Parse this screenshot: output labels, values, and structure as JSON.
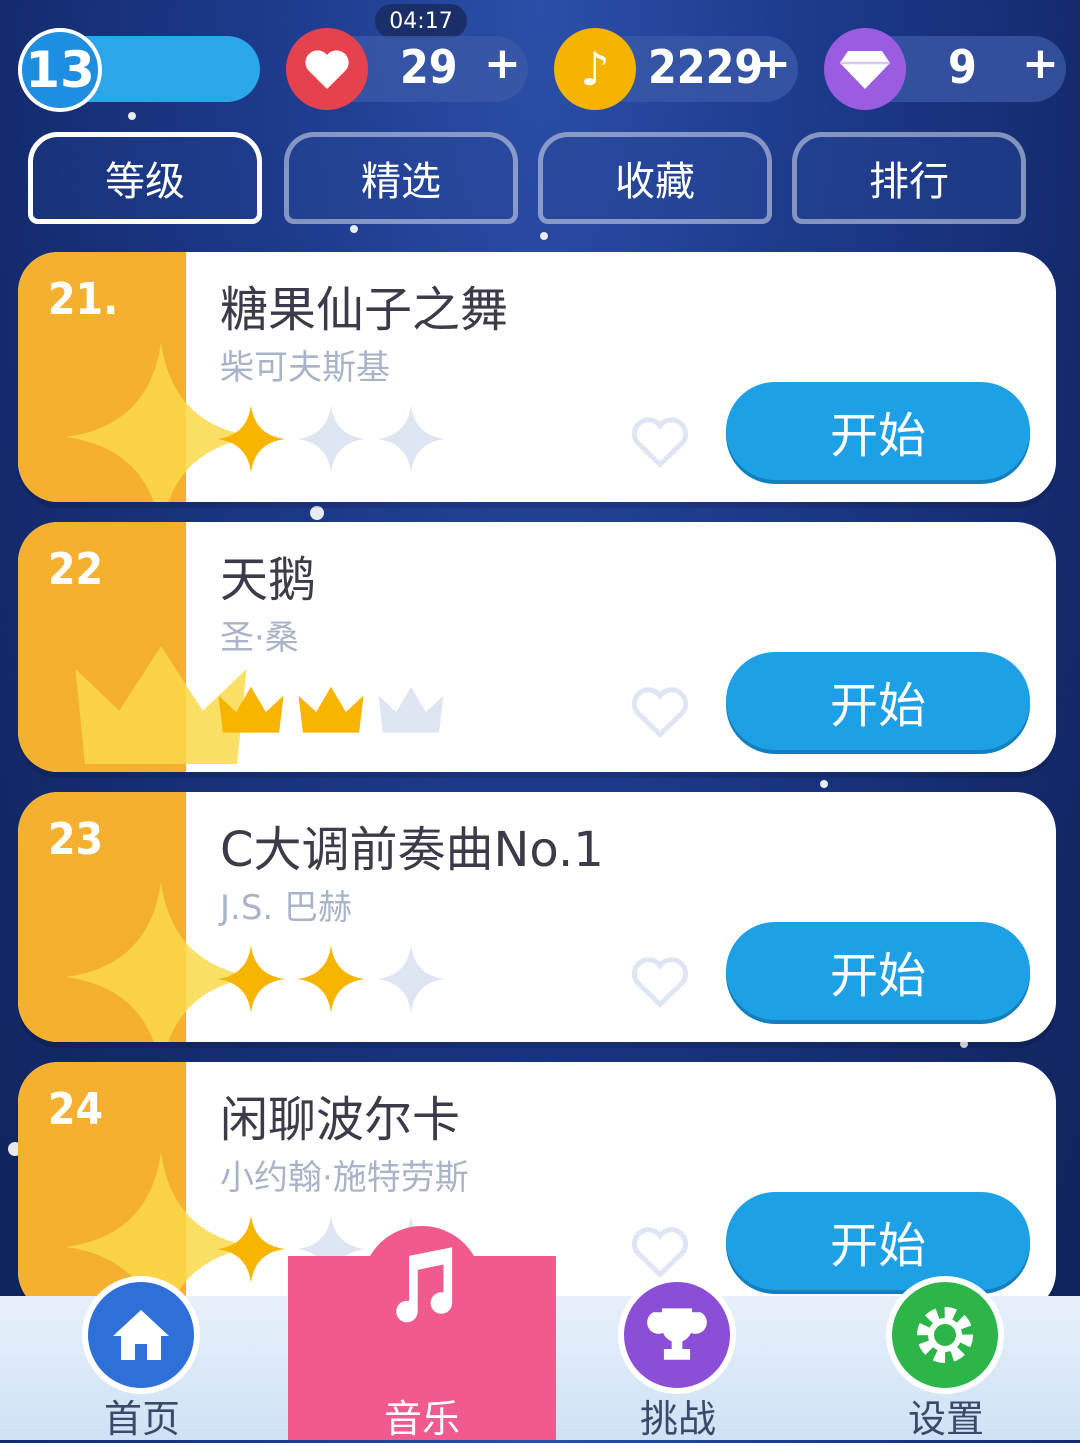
{
  "status": {
    "time": "04:17"
  },
  "player": {
    "level": "13"
  },
  "resources": {
    "lives": "29",
    "notes": "2229",
    "diamonds": "9",
    "plus": "+"
  },
  "tabs": [
    {
      "label": "等级"
    },
    {
      "label": "精选"
    },
    {
      "label": "收藏"
    },
    {
      "label": "排行"
    }
  ],
  "songs": [
    {
      "rank": "21.",
      "title": "糖果仙子之舞",
      "artist": "柴可夫斯基",
      "rating_type": "star",
      "rating": 1,
      "rating_max": 3,
      "button": "开始"
    },
    {
      "rank": "22",
      "title": "天鹅",
      "artist": "圣·桑",
      "rating_type": "crown",
      "rating": 2,
      "rating_max": 3,
      "button": "开始"
    },
    {
      "rank": "23",
      "title": "C大调前奏曲No.1",
      "artist": "J.S. 巴赫",
      "rating_type": "star",
      "rating": 2,
      "rating_max": 3,
      "button": "开始"
    },
    {
      "rank": "24",
      "title": "闲聊波尔卡",
      "artist": "小约翰·施特劳斯",
      "rating_type": "star",
      "rating": 1,
      "rating_max": 3,
      "button": "开始"
    }
  ],
  "nav": [
    {
      "label": "首页",
      "icon": "home-icon",
      "color": "#2f6fd8"
    },
    {
      "label": "音乐",
      "icon": "music-note-icon",
      "color": "#f05a8c"
    },
    {
      "label": "挑战",
      "icon": "trophy-icon",
      "color": "#8a4fd6"
    },
    {
      "label": "设置",
      "icon": "gear-icon",
      "color": "#2db54a"
    }
  ],
  "colors": {
    "accent": "#1ea0e6",
    "rank_column": "#f6b030",
    "star_filled": "#f8b500",
    "star_empty": "#dfe6f3"
  }
}
